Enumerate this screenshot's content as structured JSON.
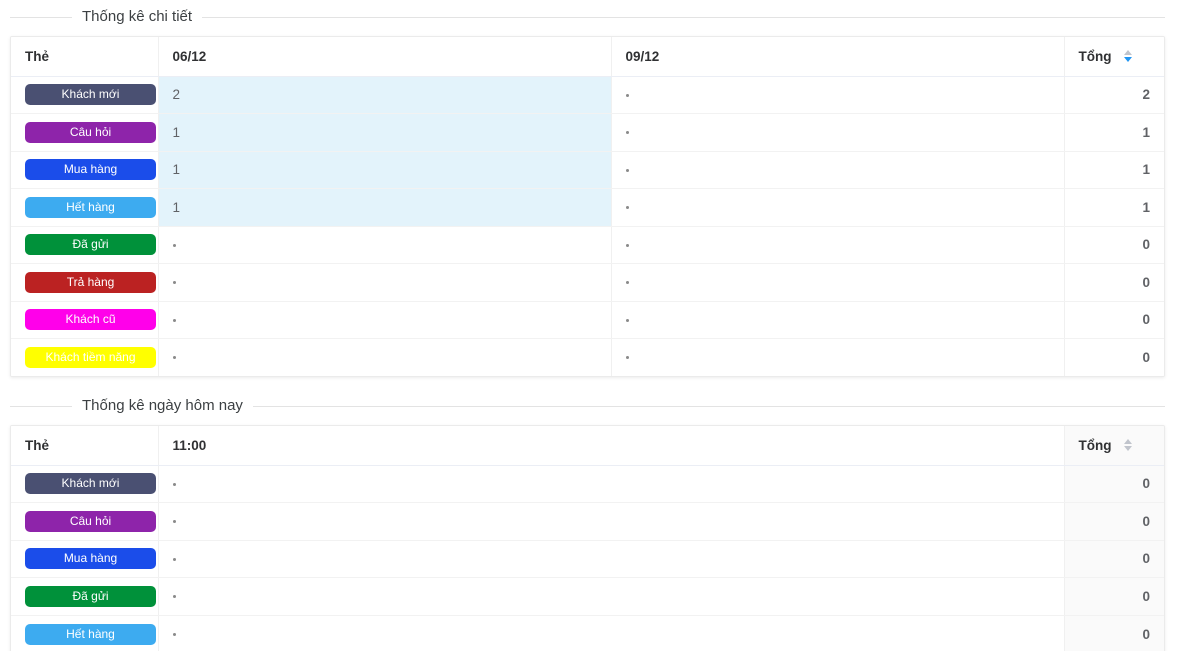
{
  "colors": {
    "tag_new_customer": "#4a5072",
    "tag_question": "#8e24aa",
    "tag_purchase": "#1b4dea",
    "tag_out_of_stock": "#3dabf0",
    "tag_shipped": "#00913a",
    "tag_returned": "#bb2222",
    "tag_old_customer": "#ff00ea",
    "tag_potential": "#ffff00",
    "highlight_cell": "#e3f3fb",
    "sort_active": "#2196f3"
  },
  "sections": [
    {
      "legend": "Thống kê chi tiết",
      "columns": {
        "tag": "Thẻ",
        "dates": [
          "06/12",
          "09/12"
        ],
        "total": "Tổng"
      },
      "sort_state": "desc",
      "rows": [
        {
          "tag": "Khách mới",
          "color_key": "tag_new_customer",
          "values": [
            "2",
            "·"
          ],
          "highlight": [
            true,
            false
          ],
          "total": "2"
        },
        {
          "tag": "Câu hỏi",
          "color_key": "tag_question",
          "values": [
            "1",
            "·"
          ],
          "highlight": [
            true,
            false
          ],
          "total": "1"
        },
        {
          "tag": "Mua hàng",
          "color_key": "tag_purchase",
          "values": [
            "1",
            "·"
          ],
          "highlight": [
            true,
            false
          ],
          "total": "1"
        },
        {
          "tag": "Hết hàng",
          "color_key": "tag_out_of_stock",
          "values": [
            "1",
            "·"
          ],
          "highlight": [
            true,
            false
          ],
          "total": "1"
        },
        {
          "tag": "Đã gửi",
          "color_key": "tag_shipped",
          "values": [
            "·",
            "·"
          ],
          "highlight": [
            false,
            false
          ],
          "total": "0"
        },
        {
          "tag": "Trả hàng",
          "color_key": "tag_returned",
          "values": [
            "·",
            "·"
          ],
          "highlight": [
            false,
            false
          ],
          "total": "0"
        },
        {
          "tag": "Khách cũ",
          "color_key": "tag_old_customer",
          "values": [
            "·",
            "·"
          ],
          "highlight": [
            false,
            false
          ],
          "total": "0"
        },
        {
          "tag": "Khách tiềm năng",
          "color_key": "tag_potential",
          "values": [
            "·",
            "·"
          ],
          "highlight": [
            false,
            false
          ],
          "total": "0"
        }
      ]
    },
    {
      "legend": "Thống kê ngày hôm nay",
      "columns": {
        "tag": "Thẻ",
        "dates": [
          "11:00"
        ],
        "total": "Tổng"
      },
      "sort_state": "none",
      "rows": [
        {
          "tag": "Khách mới",
          "color_key": "tag_new_customer",
          "values": [
            "·"
          ],
          "highlight": [
            false
          ],
          "total": "0"
        },
        {
          "tag": "Câu hỏi",
          "color_key": "tag_question",
          "values": [
            "·"
          ],
          "highlight": [
            false
          ],
          "total": "0"
        },
        {
          "tag": "Mua hàng",
          "color_key": "tag_purchase",
          "values": [
            "·"
          ],
          "highlight": [
            false
          ],
          "total": "0"
        },
        {
          "tag": "Đã gửi",
          "color_key": "tag_shipped",
          "values": [
            "·"
          ],
          "highlight": [
            false
          ],
          "total": "0"
        },
        {
          "tag": "Hết hàng",
          "color_key": "tag_out_of_stock",
          "values": [
            "·"
          ],
          "highlight": [
            false
          ],
          "total": "0"
        }
      ]
    }
  ]
}
